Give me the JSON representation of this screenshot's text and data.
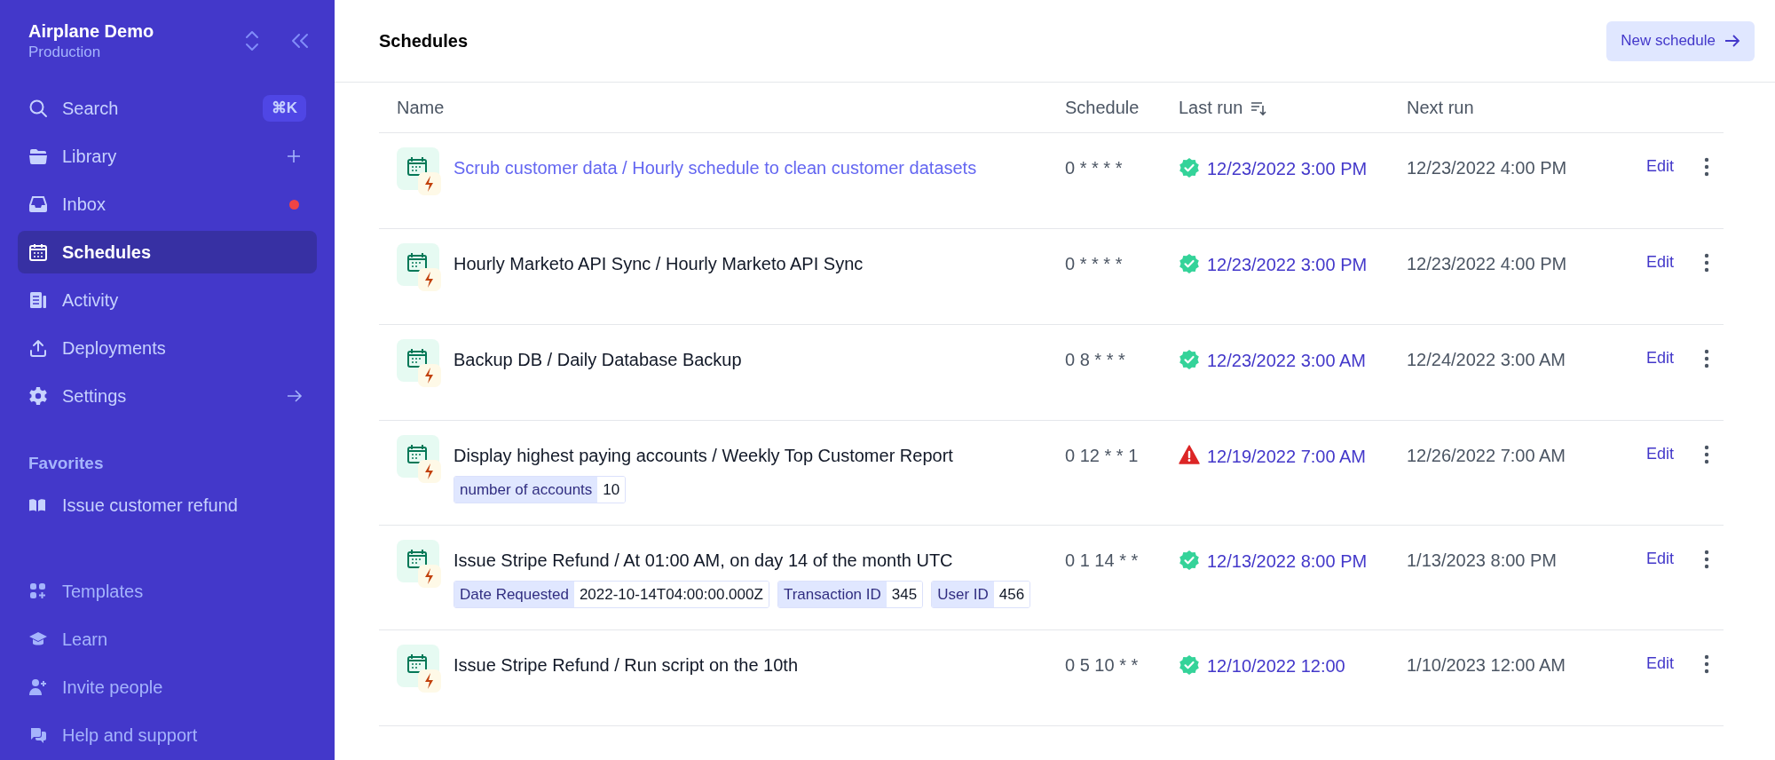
{
  "workspace": {
    "name": "Airplane Demo",
    "environment": "Production"
  },
  "nav": [
    {
      "kind": "search",
      "label": "Search",
      "shortcut": "⌘K",
      "selected": false
    },
    {
      "kind": "library",
      "label": "Library",
      "selected": false
    },
    {
      "kind": "inbox",
      "label": "Inbox",
      "unread": true,
      "selected": false
    },
    {
      "kind": "schedules",
      "label": "Schedules",
      "selected": true
    },
    {
      "kind": "activity",
      "label": "Activity",
      "selected": false
    },
    {
      "kind": "deployments",
      "label": "Deployments",
      "selected": false
    },
    {
      "kind": "settings",
      "label": "Settings",
      "selected": false
    }
  ],
  "favorites": {
    "title": "Favorites",
    "items": [
      {
        "label": "Issue customer refund"
      }
    ]
  },
  "footer_nav": [
    {
      "kind": "templates",
      "label": "Templates"
    },
    {
      "kind": "learn",
      "label": "Learn"
    },
    {
      "kind": "invite",
      "label": "Invite people"
    },
    {
      "kind": "help",
      "label": "Help and support"
    }
  ],
  "page": {
    "title": "Schedules",
    "action": "New schedule"
  },
  "table": {
    "columns": [
      {
        "label": "Name",
        "sorted": false
      },
      {
        "label": "Schedule",
        "sorted": false
      },
      {
        "label": "Last run",
        "sorted": true
      },
      {
        "label": "Next run",
        "sorted": false
      }
    ],
    "rows": [
      {
        "name": "Scrub customer data / Hourly schedule to clean customer datasets",
        "hovered": true,
        "cron": "0 * * * *",
        "last_run": "12/23/2022 3:00 PM",
        "kind": "success",
        "next_run": "12/23/2022 4:00 PM",
        "edit": "Edit"
      },
      {
        "name": "Hourly Marketo API Sync / Hourly Marketo API Sync",
        "hovered": false,
        "cron": "0 * * * *",
        "last_run": "12/23/2022 3:00 PM",
        "kind": "success",
        "next_run": "12/23/2022 4:00 PM",
        "edit": "Edit"
      },
      {
        "name": "Backup DB / Daily Database Backup",
        "hovered": false,
        "cron": "0 8 * * *",
        "last_run": "12/23/2022 3:00 AM",
        "kind": "success",
        "next_run": "12/24/2022 3:00 AM",
        "edit": "Edit"
      },
      {
        "name": "Display highest paying accounts / Weekly Top Customer Report",
        "hovered": false,
        "params": [
          {
            "label": "number of accounts",
            "value": "10"
          }
        ],
        "cron": "0 12 * * 1",
        "last_run": "12/19/2022 7:00 AM",
        "kind": "error",
        "next_run": "12/26/2022 7:00 AM",
        "edit": "Edit"
      },
      {
        "name": "Issue Stripe Refund / At 01:00 AM, on day 14 of the month UTC",
        "hovered": false,
        "params": [
          {
            "label": "Date Requested",
            "value": "2022-10-14T04:00:00.000Z"
          },
          {
            "label": "Transaction ID",
            "value": "345"
          },
          {
            "label": "User ID",
            "value": "456"
          }
        ],
        "cron": "0 1 14 * *",
        "last_run": "12/13/2022 8:00 PM",
        "kind": "success",
        "next_run": "1/13/2023 8:00 PM",
        "edit": "Edit"
      },
      {
        "name": "Issue Stripe Refund / Run script on the 10th",
        "hovered": false,
        "cron": "0 5 10 * *",
        "last_run": "12/10/2022 12:00",
        "kind": "success",
        "next_run": "1/10/2023 12:00 AM",
        "edit": "Edit"
      }
    ]
  }
}
